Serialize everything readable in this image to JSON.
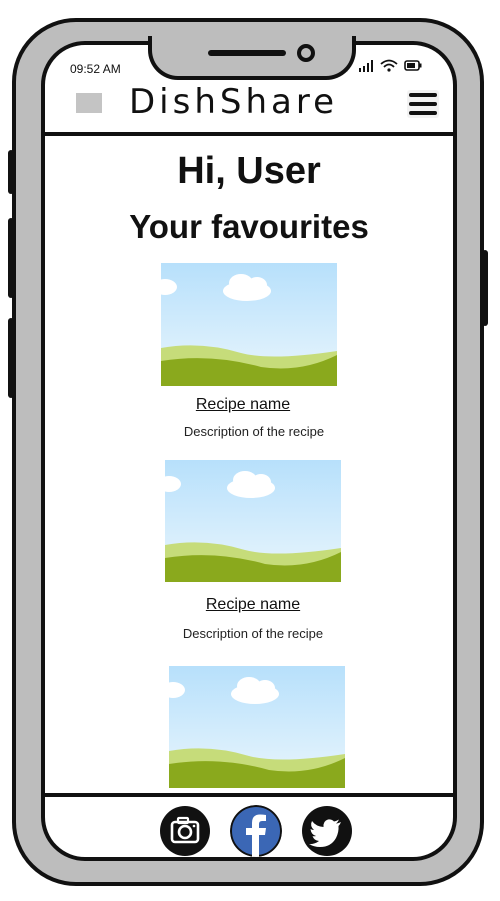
{
  "status_bar": {
    "time": "09:52 AM",
    "icons": [
      "signal-icon",
      "wifi-icon",
      "battery-icon"
    ]
  },
  "header": {
    "logo_icon": "logo-placeholder-icon",
    "brand": "DishShare",
    "menu_icon": "hamburger-menu-icon"
  },
  "main": {
    "greeting": "Hi, User",
    "section_title": "Your favourites",
    "recipes": [
      {
        "image_icon": "landscape-placeholder-icon",
        "name": "Recipe name",
        "description": "Description of the recipe"
      },
      {
        "image_icon": "landscape-placeholder-icon",
        "name": "Recipe name",
        "description": "Description of the recipe"
      },
      {
        "image_icon": "landscape-placeholder-icon"
      }
    ]
  },
  "footer": {
    "social": [
      {
        "icon": "instagram-icon"
      },
      {
        "icon": "facebook-icon",
        "color": "#3b67b5"
      },
      {
        "icon": "twitter-icon"
      }
    ]
  },
  "colors": {
    "frame": "#bdbdbd",
    "outline": "#111111",
    "sky": "#bfe3fa",
    "grass": "#8aa91d",
    "grass_light": "#c6dc7a"
  }
}
